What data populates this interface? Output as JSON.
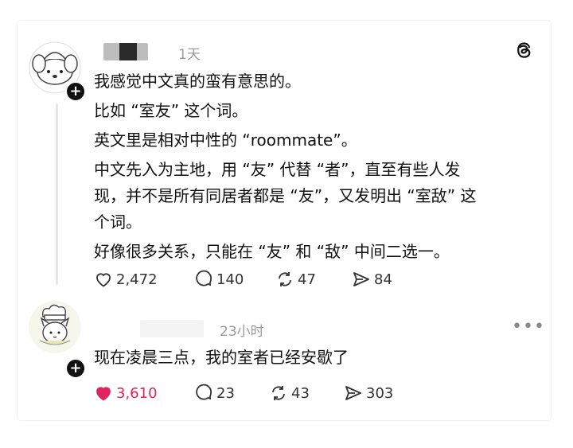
{
  "post": {
    "time": "1天",
    "lines": [
      "我感觉中文真的蛮有意思的。",
      "比如 “室友” 这个词。",
      "英文里是相对中性的 “roommate”。",
      "中文先入为主地，用 “友” 代替 “者”，直至有些人发",
      "现，并不是所有同居者都是 “友”，又发明出 “室敌” 这",
      "个词。",
      "好像很多关系，只能在 “友” 和 “敌” 中间二选一。"
    ],
    "likes": "2,472",
    "replies": "140",
    "reposts": "47",
    "shares": "84"
  },
  "reply": {
    "time": "23小时",
    "text": "现在凌晨三点，我的室者已经安歇了",
    "likes": "3,610",
    "replies": "23",
    "reposts": "43",
    "shares": "303"
  },
  "colors": {
    "like_active": "#e0245e",
    "muted": "#9a9a9a"
  },
  "icons": [
    "threads-logo-icon",
    "heart-icon",
    "comment-icon",
    "repost-icon",
    "share-icon",
    "more-icon",
    "plus-icon"
  ]
}
